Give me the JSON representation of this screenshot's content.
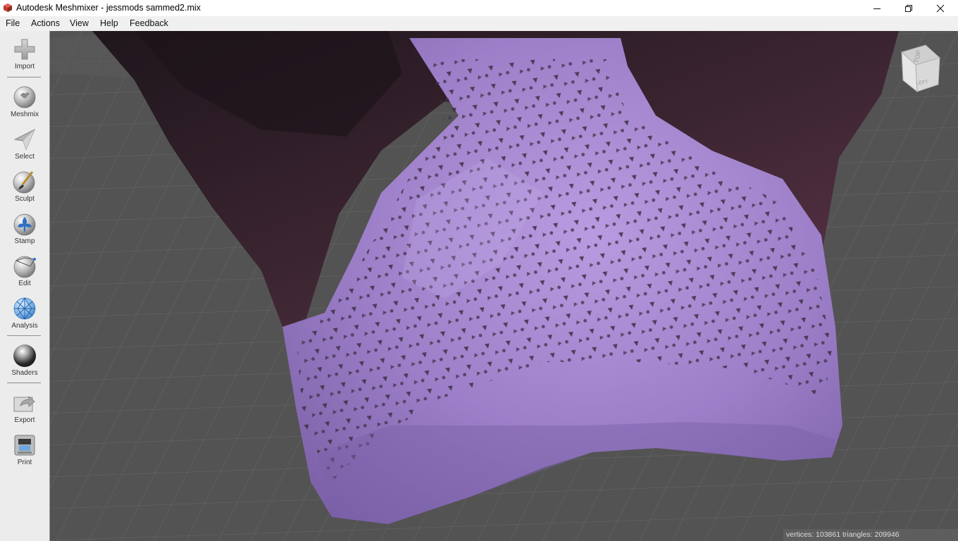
{
  "window": {
    "title": "Autodesk Meshmixer - jessmods sammed2.mix"
  },
  "menu": [
    "File",
    "Actions",
    "View",
    "Help",
    "Feedback"
  ],
  "toolbar": {
    "import": "Import",
    "meshmix": "Meshmix",
    "select": "Select",
    "sculpt": "Sculpt",
    "stamp": "Stamp",
    "edit": "Edit",
    "analysis": "Analysis",
    "shaders": "Shaders",
    "export": "Export",
    "print": "Print"
  },
  "viewcube": {
    "top": "TOP",
    "left": "LEFT"
  },
  "status": "vertices: 103861 triangles: 209946",
  "colors": {
    "mesh": "#9a7cc4",
    "grid_background": "#555555",
    "body_dark": "#3a2430"
  }
}
